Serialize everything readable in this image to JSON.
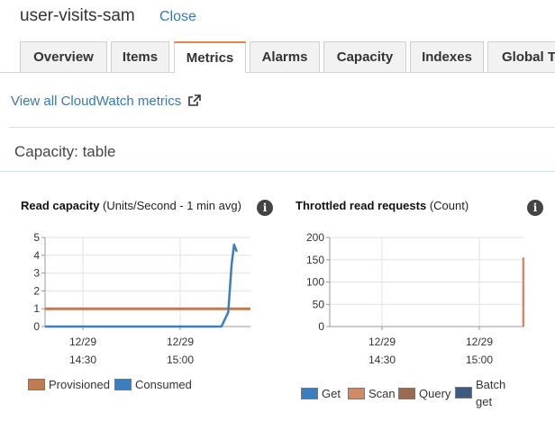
{
  "header": {
    "title": "user-visits-sam",
    "close_label": "Close"
  },
  "tabs": [
    {
      "label": "Overview",
      "active": false
    },
    {
      "label": "Items",
      "active": false
    },
    {
      "label": "Metrics",
      "active": true
    },
    {
      "label": "Alarms",
      "active": false
    },
    {
      "label": "Capacity",
      "active": false
    },
    {
      "label": "Indexes",
      "active": false
    },
    {
      "label": "Global T",
      "active": false
    }
  ],
  "cloudwatch_link": {
    "label": "View all CloudWatch metrics",
    "icon": "external-link-icon"
  },
  "section": {
    "title": "Capacity: table"
  },
  "colors": {
    "provisioned": "#c07b52",
    "consumed": "#3b7dbf",
    "get": "#3b7dbf",
    "scan": "#d08a65",
    "query": "#9c6a4e",
    "batch_get": "#3d5b82"
  },
  "read_chart": {
    "title_bold": "Read capacity",
    "title_rest": " (Units/Second - 1 min avg)",
    "info_icon": "info-icon",
    "legend": [
      {
        "label": "Provisioned"
      },
      {
        "label": "Consumed"
      }
    ]
  },
  "throttle_chart": {
    "title_bold": "Throttled read requests",
    "title_rest": " (Count)",
    "info_icon": "info-icon",
    "legend": [
      {
        "label": "Get"
      },
      {
        "label": "Scan"
      },
      {
        "label": "Query"
      },
      {
        "label": "Batch get"
      }
    ]
  },
  "chart_data": [
    {
      "type": "line",
      "title": "Read capacity",
      "ylim": [
        0,
        5
      ],
      "y_ticks": [
        "0",
        "1",
        "2",
        "3",
        "4",
        "5"
      ],
      "x_ticks": [
        {
          "date": "12/29",
          "time": "14:30"
        },
        {
          "date": "12/29",
          "time": "15:00"
        }
      ],
      "time_range_minutes": [
        0,
        60
      ],
      "series": [
        {
          "name": "Provisioned",
          "points": [
            [
              0,
              1
            ],
            [
              60,
              1
            ]
          ]
        },
        {
          "name": "Consumed",
          "points": [
            [
              0,
              0
            ],
            [
              51.5,
              0
            ],
            [
              53.5,
              0.8
            ],
            [
              54.5,
              3.5
            ],
            [
              55.2,
              4.6
            ],
            [
              56,
              4.2
            ]
          ]
        }
      ]
    },
    {
      "type": "line",
      "title": "Throttled read requests",
      "ylim": [
        0,
        200
      ],
      "y_ticks": [
        "0",
        "50",
        "100",
        "150",
        "200"
      ],
      "x_ticks": [
        {
          "date": "12/29",
          "time": "14:30"
        },
        {
          "date": "12/29",
          "time": "15:00"
        }
      ],
      "time_range_minutes": [
        0,
        60
      ],
      "series": [
        {
          "name": "Scan",
          "points": [
            [
              59.7,
              0
            ],
            [
              59.7,
              155
            ]
          ]
        }
      ]
    }
  ]
}
